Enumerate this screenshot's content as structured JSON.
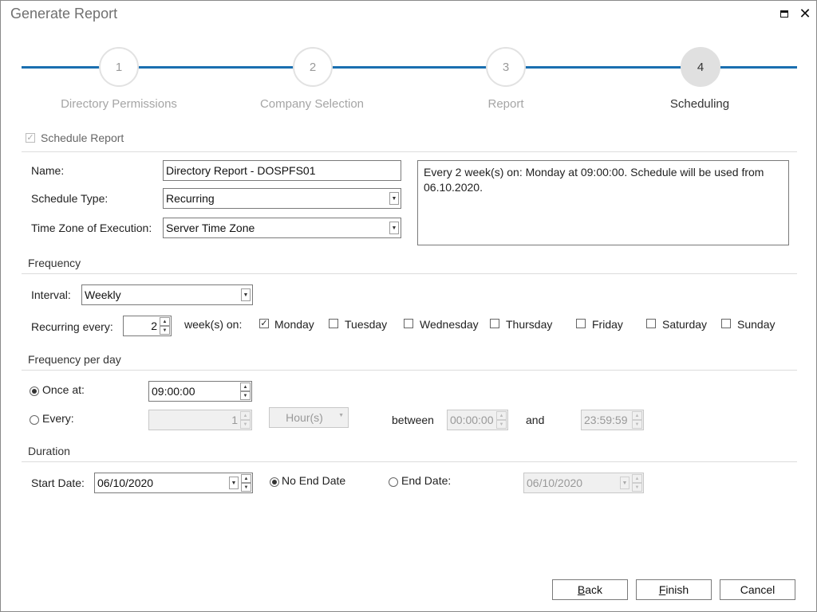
{
  "window": {
    "title": "Generate Report"
  },
  "steps": [
    {
      "number": "1",
      "label": "Directory Permissions"
    },
    {
      "number": "2",
      "label": "Company Selection"
    },
    {
      "number": "3",
      "label": "Report"
    },
    {
      "number": "4",
      "label": "Scheduling"
    }
  ],
  "active_step": 4,
  "schedule_report": {
    "label": "Schedule Report",
    "checked": true
  },
  "general": {
    "name_label": "Name:",
    "name_value": "Directory Report - DOSPFS01",
    "schedule_type_label": "Schedule Type:",
    "schedule_type_value": "Recurring",
    "timezone_label": "Time Zone of Execution:",
    "timezone_value": "Server Time Zone",
    "summary": "Every 2 week(s) on: Monday at 09:00:00. Schedule will be used from 06.10.2020."
  },
  "frequency": {
    "title": "Frequency",
    "interval_label": "Interval:",
    "interval_value": "Weekly",
    "recurring_label": "Recurring every:",
    "recurring_value": "2",
    "weeks_on_label": "week(s) on:",
    "days": [
      {
        "label": "Monday",
        "checked": true
      },
      {
        "label": "Tuesday",
        "checked": false
      },
      {
        "label": "Wednesday",
        "checked": false
      },
      {
        "label": "Thursday",
        "checked": false
      },
      {
        "label": "Friday",
        "checked": false
      },
      {
        "label": "Saturday",
        "checked": false
      },
      {
        "label": "Sunday",
        "checked": false
      }
    ]
  },
  "per_day": {
    "title": "Frequency per day",
    "once_label": "Once at:",
    "once_value": "09:00:00",
    "once_selected": true,
    "every_label": "Every:",
    "every_value": "1",
    "every_unit": "Hour(s)",
    "between_label": "between",
    "between_start": "00:00:00",
    "and_label": "and",
    "between_end": "23:59:59"
  },
  "duration": {
    "title": "Duration",
    "start_label": "Start Date:",
    "start_value": "06/10/2020",
    "no_end_label": "No End Date",
    "no_end_selected": true,
    "end_label": "End Date:",
    "end_value": "06/10/2020"
  },
  "buttons": {
    "back_mnemonic": "B",
    "back_rest": "ack",
    "finish_mnemonic": "F",
    "finish_rest": "inish",
    "cancel": "Cancel"
  },
  "colors": {
    "accent": "#1a6fb0",
    "active_step_bg": "#e0e0e0"
  },
  "icons": {
    "maximize": "maximize-icon",
    "close": "close-icon",
    "dropdown": "chevron-down-icon",
    "spinner": "spinner-arrows-icon",
    "check": "checkmark-icon"
  }
}
